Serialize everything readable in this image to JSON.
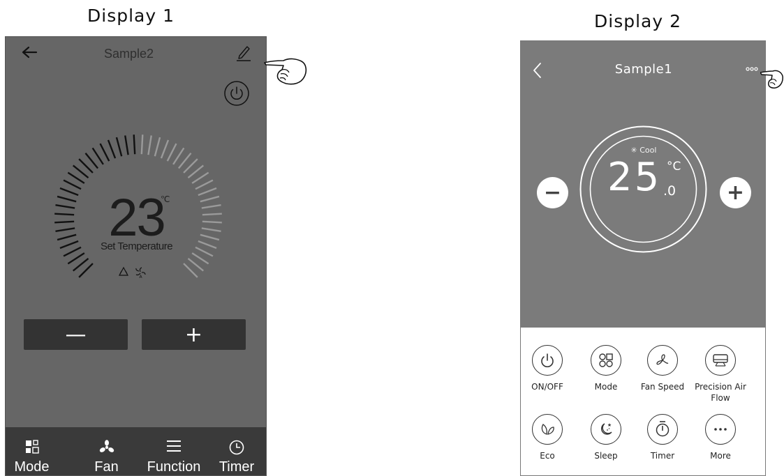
{
  "captions": {
    "display1": "Display 1",
    "display2": "Display 2"
  },
  "display1": {
    "title": "Sample2",
    "temperature": "23",
    "unit": "℃",
    "set_temperature_label": "Set Temperature",
    "minus_label": "—",
    "plus_label": "+",
    "dial_level": 0.5,
    "bottom_tabs": [
      {
        "label": "Mode",
        "icon": "mode-icon"
      },
      {
        "label": "Fan",
        "icon": "fan-icon"
      },
      {
        "label": "Function",
        "icon": "menu-icon"
      },
      {
        "label": "Timer",
        "icon": "clock-icon"
      }
    ],
    "colors": {
      "screen": "#666666",
      "bar": "#3a3a3a",
      "button": "#333333"
    }
  },
  "display2": {
    "title": "Sample1",
    "mode": "✳ Cool",
    "temperature": "25",
    "unit": "°C",
    "decimal": ".0",
    "minus_label": "−",
    "plus_label": "+",
    "controls": [
      {
        "label": "ON/OFF",
        "icon": "power-icon"
      },
      {
        "label": "Mode",
        "icon": "mode-grid-icon"
      },
      {
        "label": "Fan Speed",
        "icon": "fan-speed-icon"
      },
      {
        "label": "Precision Air Flow",
        "icon": "air-flow-icon"
      },
      {
        "label": "Eco",
        "icon": "eco-leaf-icon"
      },
      {
        "label": "Sleep",
        "icon": "sleep-moon-icon"
      },
      {
        "label": "Timer",
        "icon": "timer-icon"
      },
      {
        "label": "More",
        "icon": "more-dots-icon"
      }
    ],
    "colors": {
      "screen": "#7b7b7b",
      "panel": "#ffffff"
    }
  }
}
